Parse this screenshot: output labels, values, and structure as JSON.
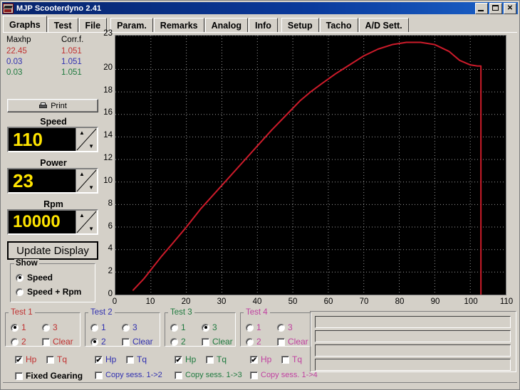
{
  "window": {
    "title": "MJP Scooterdyno 2.41",
    "icon": "app-icon",
    "buttons": {
      "minimize": "_",
      "maximize": "□",
      "close": "✕"
    }
  },
  "tabs": [
    {
      "label": "Graphs",
      "active": true
    },
    {
      "label": "Test",
      "active": false
    },
    {
      "label": "File",
      "active": false
    },
    {
      "label": "Param.",
      "active": false
    },
    {
      "label": "Remarks",
      "active": false
    },
    {
      "label": "Analog",
      "active": false
    },
    {
      "label": "Info",
      "active": false
    },
    {
      "label": "Setup",
      "active": false
    },
    {
      "label": "Tacho",
      "active": false
    },
    {
      "label": "A/D Sett.",
      "active": false
    }
  ],
  "left_panel": {
    "headers": {
      "maxhp": "Maxhp",
      "corrf": "Corr.f."
    },
    "rows": [
      {
        "maxhp": "22.45",
        "corrf": "1.051",
        "color": "#c03030"
      },
      {
        "maxhp": "0.03",
        "corrf": "1.051",
        "color": "#3030b0"
      },
      {
        "maxhp": "0.03",
        "corrf": "1.051",
        "color": "#1f7a3f"
      }
    ],
    "print_label": "Print",
    "fields": [
      {
        "caption": "Speed",
        "value": "110"
      },
      {
        "caption": "Power",
        "value": "23"
      },
      {
        "caption": "Rpm",
        "value": "10000"
      }
    ],
    "update_label": "Update Display",
    "show": {
      "legend": "Show",
      "options": [
        {
          "label": "Speed",
          "selected": true
        },
        {
          "label": "Speed + Rpm",
          "selected": false
        }
      ]
    }
  },
  "tests": [
    {
      "title": "Test 1",
      "color": "#c03030",
      "radios": [
        {
          "label": "1",
          "selected": true
        },
        {
          "label": "3",
          "selected": false
        },
        {
          "label": "2",
          "selected": false
        }
      ],
      "clear": {
        "label": "Clear",
        "checked": false
      },
      "hp": {
        "label": "Hp",
        "checked": true
      },
      "tq": {
        "label": "Tq",
        "checked": false
      },
      "extra": {
        "label": "Fixed Gearing",
        "checked": false,
        "color": "#000000"
      }
    },
    {
      "title": "Test 2",
      "color": "#3030b0",
      "radios": [
        {
          "label": "1",
          "selected": false
        },
        {
          "label": "3",
          "selected": false
        },
        {
          "label": "2",
          "selected": true
        }
      ],
      "clear": {
        "label": "Clear",
        "checked": false
      },
      "hp": {
        "label": "Hp",
        "checked": true
      },
      "tq": {
        "label": "Tq",
        "checked": false
      },
      "extra": {
        "label": "Copy sess. 1->2",
        "checked": false,
        "color": "#3030b0"
      }
    },
    {
      "title": "Test 3",
      "color": "#1f7a3f",
      "radios": [
        {
          "label": "1",
          "selected": false
        },
        {
          "label": "3",
          "selected": true
        },
        {
          "label": "2",
          "selected": false
        }
      ],
      "clear": {
        "label": "Clear",
        "checked": false
      },
      "hp": {
        "label": "Hp",
        "checked": true
      },
      "tq": {
        "label": "Tq",
        "checked": false
      },
      "extra": {
        "label": "Copy sess. 1->3",
        "checked": false,
        "color": "#1f7a3f"
      }
    },
    {
      "title": "Test 4",
      "color": "#c040a0",
      "radios": [
        {
          "label": "1",
          "selected": false
        },
        {
          "label": "3",
          "selected": false
        },
        {
          "label": "2",
          "selected": false
        }
      ],
      "clear": {
        "label": "Clear",
        "checked": false
      },
      "hp": {
        "label": "Hp",
        "checked": true
      },
      "tq": {
        "label": "Tq",
        "checked": false
      },
      "extra": {
        "label": "Copy sess. 1->4",
        "checked": false,
        "color": "#c040a0"
      }
    }
  ],
  "text_fields": [
    {
      "value": "",
      "placeholder": ""
    },
    {
      "value": "",
      "placeholder": ""
    },
    {
      "value": "",
      "placeholder": ""
    },
    {
      "value": "",
      "placeholder": ""
    }
  ],
  "chart_data": {
    "type": "line",
    "title": "",
    "xlabel": "",
    "ylabel": "",
    "background": "#000000",
    "grid": true,
    "grid_color": "#9a9a9a",
    "legend": "none",
    "xlim": [
      0,
      110
    ],
    "ylim": [
      0,
      23
    ],
    "xticks": [
      0,
      10,
      20,
      30,
      40,
      50,
      60,
      70,
      80,
      90,
      100,
      110
    ],
    "yticks": [
      0,
      2,
      4,
      6,
      8,
      10,
      12,
      14,
      16,
      18,
      20,
      23
    ],
    "series": [
      {
        "name": "Test 1 Hp",
        "color": "#cc1b2a",
        "x": [
          5,
          8,
          10,
          13,
          16,
          20,
          24,
          28,
          32,
          36,
          40,
          44,
          48,
          52,
          55,
          58,
          62,
          66,
          70,
          74,
          78,
          82,
          86,
          90,
          94,
          97,
          100,
          102,
          103,
          103
        ],
        "y": [
          0.4,
          1.4,
          2.2,
          3.4,
          4.5,
          6.0,
          7.6,
          9.0,
          10.4,
          11.8,
          13.2,
          14.6,
          15.9,
          17.2,
          18.0,
          18.7,
          19.6,
          20.4,
          21.2,
          21.8,
          22.2,
          22.4,
          22.4,
          22.2,
          21.6,
          20.8,
          20.4,
          20.3,
          20.3,
          0.0
        ]
      }
    ]
  }
}
